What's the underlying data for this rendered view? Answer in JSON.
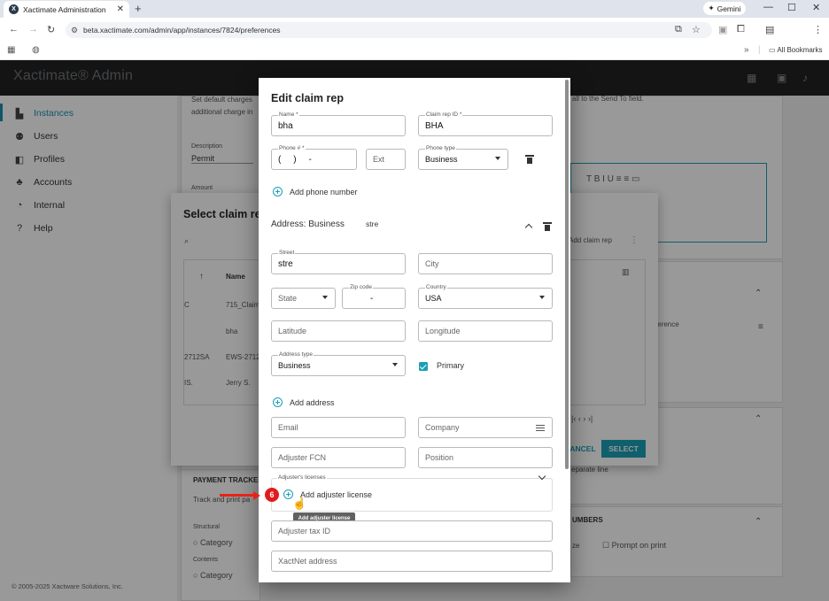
{
  "browser": {
    "tab_title": "Xactimate Administration",
    "tab_close": "✕",
    "new_tab": "+",
    "gemini_label": "Gemini",
    "url": "beta.xactimate.com/admin/app/instances/7824/preferences",
    "all_bookmarks": "All Bookmarks",
    "win_min": "—",
    "win_max": "☐",
    "win_close": "✕"
  },
  "app": {
    "brand": "Xactimate® Admin"
  },
  "sidebar": {
    "items": [
      {
        "label": "Instances",
        "icon": "bar-chart-icon"
      },
      {
        "label": "Users",
        "icon": "people-icon"
      },
      {
        "label": "Profiles",
        "icon": "profiles-icon"
      },
      {
        "label": "Accounts",
        "icon": "accounts-icon"
      },
      {
        "label": "Internal",
        "icon": "internal-icon"
      },
      {
        "label": "Help",
        "icon": "help-icon"
      }
    ],
    "copyright": "© 2005-2025 Xactware Solutions, Inc."
  },
  "background": {
    "hint_line1": "Set default charges",
    "hint_line2": "additional charge in",
    "description_label": "Description",
    "description_value": "Permit",
    "amount_label": "Amount",
    "send_to_text": "all to the Send To field.",
    "payment_tracker": "PAYMENT TRACKER",
    "track_text": "Track and print pa",
    "structural": "Structural",
    "category": "Category",
    "contents": "Contents",
    "reference": "ference",
    "separate_line": "eparate line",
    "numbers_header": "UMBERS",
    "prompt_on_print": "Prompt on print",
    "ze": "ze",
    "select_dialog": {
      "title": "Select claim re",
      "col_name": "Name",
      "rows": [
        {
          "c1": "C",
          "c2": "715_Claim"
        },
        {
          "c1": "",
          "c2": "bha"
        },
        {
          "c1": "2712SA",
          "c2": "EWS-2712"
        },
        {
          "c1": "IS.",
          "c2": "Jerry S."
        }
      ],
      "add_claim_rep": "Add claim rep",
      "cancel": "ANCEL",
      "select": "SELECT"
    }
  },
  "modal": {
    "title": "Edit claim rep",
    "name_label": "Name *",
    "name_value": "bha",
    "claim_rep_id_label": "Claim rep ID *",
    "claim_rep_id_value": "BHA",
    "phone_label": "Phone # *",
    "phone_value": "(     )     -",
    "ext_placeholder": "Ext",
    "phone_type_label": "Phone type",
    "phone_type_value": "Business",
    "add_phone_number": "Add phone number",
    "address_section_title": "Address: Business",
    "address_section_summary": "stre",
    "street_label": "Street",
    "street_value": "stre",
    "city_placeholder": "City",
    "state_placeholder": "State",
    "zip_label": "Zip code",
    "zip_value": "-",
    "country_label": "Country",
    "country_value": "USA",
    "latitude_placeholder": "Latitude",
    "longitude_placeholder": "Longitude",
    "address_type_label": "Address type",
    "address_type_value": "Business",
    "primary_label": "Primary",
    "add_address": "Add address",
    "email_placeholder": "Email",
    "company_placeholder": "Company",
    "adjuster_fcn_placeholder": "Adjuster FCN",
    "position_placeholder": "Position",
    "licenses_label": "Adjuster's licenses",
    "add_adjuster_license": "Add adjuster license",
    "tooltip": "Add adjuster license",
    "adjuster_tax_id_placeholder": "Adjuster tax ID",
    "xactnet_placeholder": "XactNet address"
  },
  "annotation": {
    "step_number": "6"
  },
  "colors": {
    "accent": "#1b9fb5",
    "annotation_red": "#e01d1d",
    "appbar": "#222222"
  }
}
